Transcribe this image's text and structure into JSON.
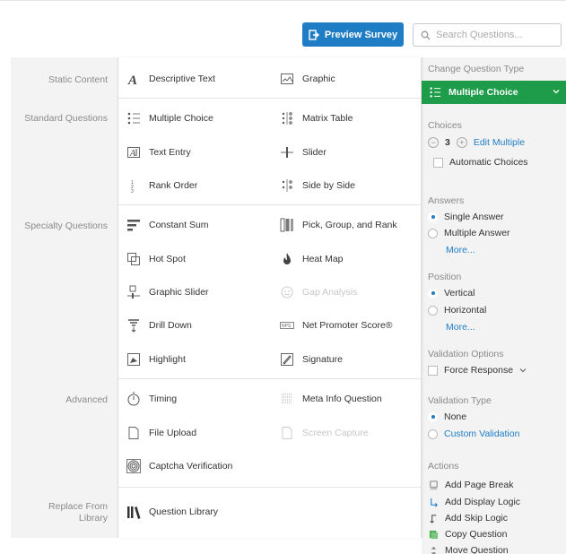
{
  "toolbar": {
    "preview_label": "Preview Survey",
    "search_placeholder": "Search Questions..."
  },
  "categories": {
    "static": "Static Content",
    "standard": "Standard Questions",
    "specialty": "Specialty Questions",
    "advanced": "Advanced",
    "replace_line1": "Replace From",
    "replace_line2": "Library"
  },
  "items": {
    "descriptive_text": "Descriptive Text",
    "graphic": "Graphic",
    "multiple_choice": "Multiple Choice",
    "matrix_table": "Matrix Table",
    "text_entry": "Text Entry",
    "slider": "Slider",
    "rank_order": "Rank Order",
    "side_by_side": "Side by Side",
    "constant_sum": "Constant Sum",
    "pick_group_rank": "Pick, Group, and Rank",
    "hot_spot": "Hot Spot",
    "heat_map": "Heat Map",
    "graphic_slider": "Graphic Slider",
    "gap_analysis": "Gap Analysis",
    "drill_down": "Drill Down",
    "net_promoter": "Net Promoter Score®",
    "highlight": "Highlight",
    "signature": "Signature",
    "timing": "Timing",
    "meta_info": "Meta Info Question",
    "file_upload": "File Upload",
    "screen_capture": "Screen Capture",
    "captcha": "Captcha Verification",
    "question_library": "Question Library"
  },
  "right_panel": {
    "change_type_heading": "Change Question Type",
    "selected_type": "Multiple Choice",
    "choices_heading": "Choices",
    "choices_count": "3",
    "edit_multiple": "Edit Multiple",
    "automatic_choices": "Automatic Choices",
    "answers_heading": "Answers",
    "single_answer": "Single Answer",
    "multiple_answer": "Multiple Answer",
    "answers_more": "More...",
    "position_heading": "Position",
    "vertical": "Vertical",
    "horizontal": "Horizontal",
    "position_more": "More...",
    "validation_options_heading": "Validation Options",
    "force_response": "Force Response",
    "validation_type_heading": "Validation Type",
    "none": "None",
    "custom_validation": "Custom Validation",
    "actions_heading": "Actions",
    "add_page_break": "Add Page Break",
    "add_display_logic": "Add Display Logic",
    "add_skip_logic": "Add Skip Logic",
    "copy_question": "Copy Question",
    "move_question": "Move Question"
  },
  "colors": {
    "accent_blue": "#1f7dc5",
    "selected_green": "#1e9c49"
  }
}
